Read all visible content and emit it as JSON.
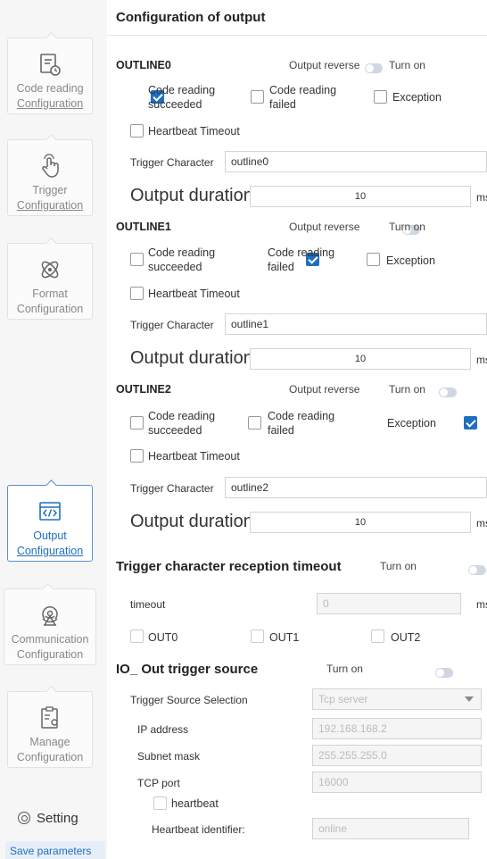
{
  "sidebar": {
    "items": [
      {
        "label1": "Code reading",
        "label2": "Configuration",
        "icon": "code-reading-icon"
      },
      {
        "label1": "Trigger",
        "label2": "Configuration",
        "icon": "hand-pointer-icon"
      },
      {
        "label1": "Format",
        "label2": "Configuration",
        "icon": "format-atom-icon"
      },
      {
        "label1": "Output",
        "label2": "Configuration",
        "icon": "code-window-icon"
      },
      {
        "label1": "Communication",
        "label2": "Configuration",
        "icon": "antenna-icon"
      },
      {
        "label1": "Manage",
        "label2": "Configuration",
        "icon": "manage-clipboard-icon"
      }
    ],
    "setting_label": "Setting",
    "save_label": "Save parameters"
  },
  "header": {
    "title": "Configuration of output"
  },
  "outlines": [
    {
      "name": "OUTLINE0",
      "reverse_label": "Output reverse",
      "turn_on": "Turn on",
      "cb1": "Code reading",
      "cb1b": "succeeded",
      "cb2": "Code reading",
      "cb2b": "failed",
      "cb3": "Exception",
      "cb4": "Heartbeat Timeout",
      "checked": [
        true,
        false,
        false,
        false
      ],
      "trigger_label": "Trigger Character",
      "trigger_value": "outline0",
      "duration_label": "Output duration:",
      "duration_value": "10",
      "unit": "ms"
    },
    {
      "name": "OUTLINE1",
      "reverse_label": "Output reverse",
      "turn_on": "Turn on",
      "cb1": "Code reading",
      "cb1b": "succeeded",
      "cb2": "Code reading",
      "cb2b": "failed",
      "cb3": "Exception",
      "cb4": "Heartbeat Timeout",
      "checked": [
        false,
        true,
        false,
        false
      ],
      "trigger_label": "Trigger Character",
      "trigger_value": "outline1",
      "duration_label": "Output duration:",
      "duration_value": "10",
      "unit": "ms"
    },
    {
      "name": "OUTLINE2",
      "reverse_label": "Output reverse",
      "turn_on": "Turn on",
      "cb1": "Code reading",
      "cb1b": "succeeded",
      "cb2": "Code reading",
      "cb2b": "failed",
      "cb3": "Exception",
      "cb4": "Heartbeat Timeout",
      "checked": [
        false,
        false,
        true,
        false
      ],
      "trigger_label": "Trigger Character",
      "trigger_value": "outline2",
      "duration_label": "Output duration:",
      "duration_value": "10",
      "unit": "ms"
    }
  ],
  "reception": {
    "title": "Trigger character reception timeout",
    "turn_on": "Turn on",
    "timeout_label": "timeout",
    "timeout_value": "0",
    "unit": "ms",
    "out0": "OUT0",
    "out1": "OUT1",
    "out2": "OUT2"
  },
  "io": {
    "title": "IO_ Out trigger source",
    "turn_on": "Turn on",
    "source_label": "Trigger Source Selection",
    "source_value": "Tcp server",
    "ip_label": "IP address",
    "ip_value": "192.168.168.2",
    "mask_label": "Subnet mask",
    "mask_value": "255.255.255.0",
    "port_label": "TCP port",
    "port_value": "16000",
    "heartbeat_label": "heartbeat",
    "hb_id_label": "Heartbeat identifier:",
    "hb_id_value": "online"
  },
  "colors": {
    "accent": "#1e6fbf",
    "toggle_off": "#d0d7e2"
  }
}
